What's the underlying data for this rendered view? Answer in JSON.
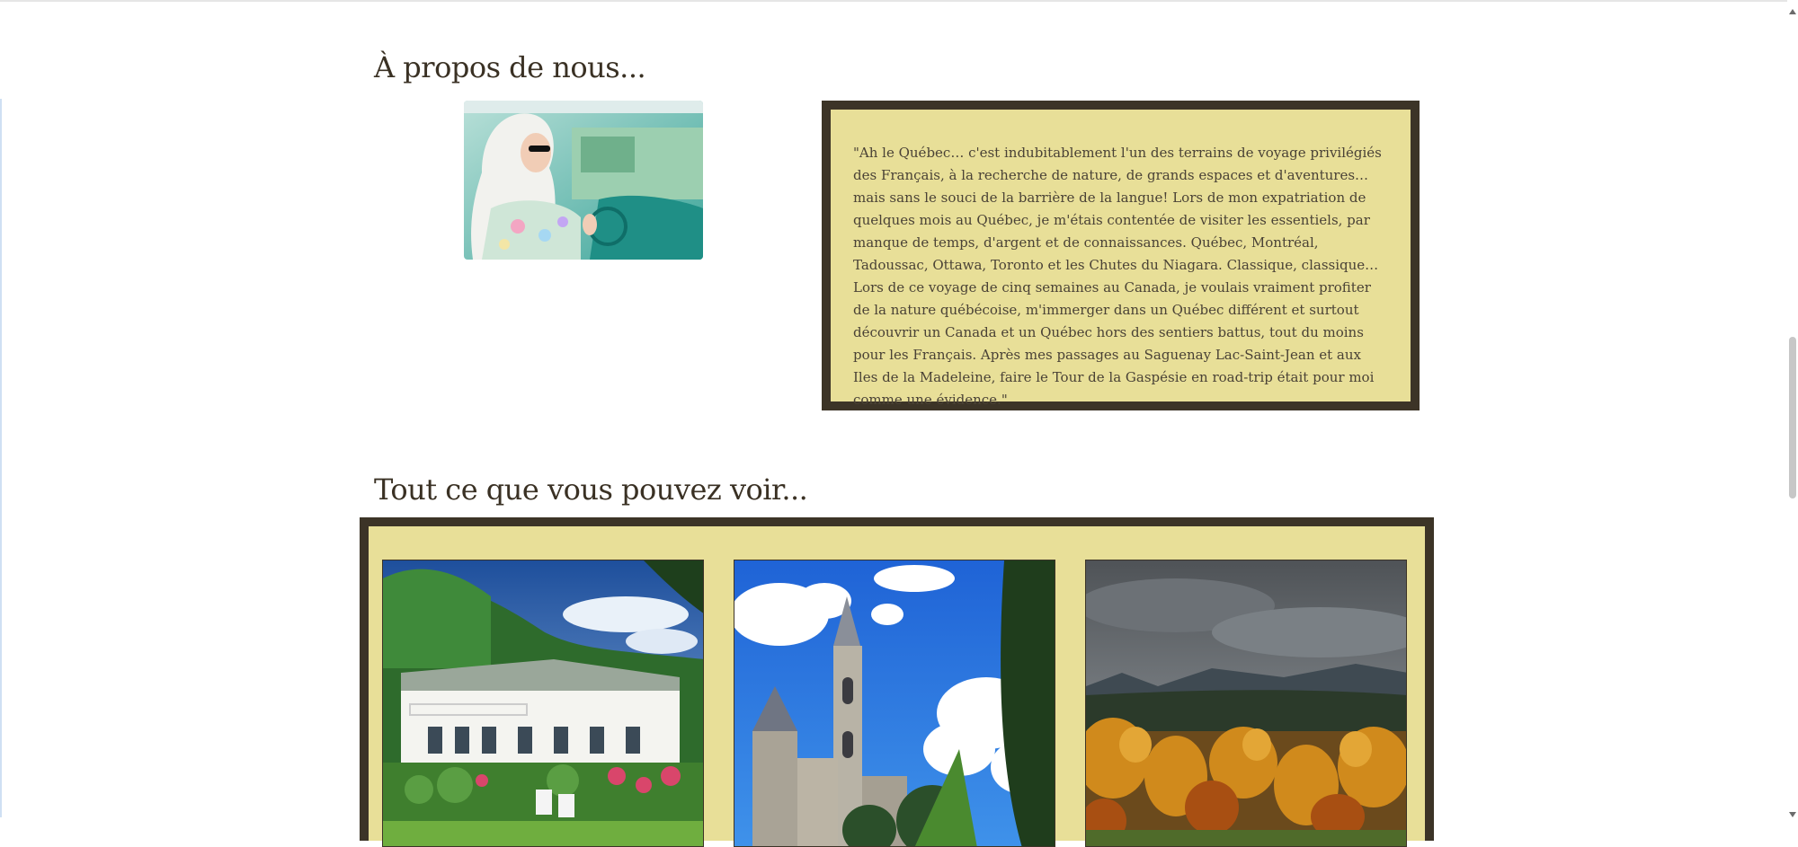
{
  "about": {
    "title": "À propos de nous...",
    "quote": "\"Ah le Québec… c'est indubitablement l'un des terrains de voyage privilégiés des Français, à la recherche de nature, de grands espaces et d'aventures… mais sans le souci de la barrière de la langue! Lors de mon expatriation de quelques mois au Québec, je m'étais contentée de visiter les essentiels, par manque de temps, d'argent et de connaissances. Québec, Montréal, Tadoussac, Ottawa, Toronto et les Chutes du Niagara. Classique, classique… Lors de ce voyage de cinq semaines au Canada, je voulais vraiment profiter de la nature québécoise, m'immerger dans un Québec différent et surtout découvrir un Canada et un Québec hors des sentiers battus, tout du moins pour les Français. Après mes passages au Saguenay Lac-Saint-Jean et aux Iles de la Madeleine, faire le Tour de la Gaspésie en road-trip était pour moi comme une évidence.\""
  },
  "gallery": {
    "title": "Tout ce que vous pouvez voir..."
  },
  "colors": {
    "frame": "#3c3427",
    "panel": "#e8df98",
    "heading": "#3a3124"
  }
}
